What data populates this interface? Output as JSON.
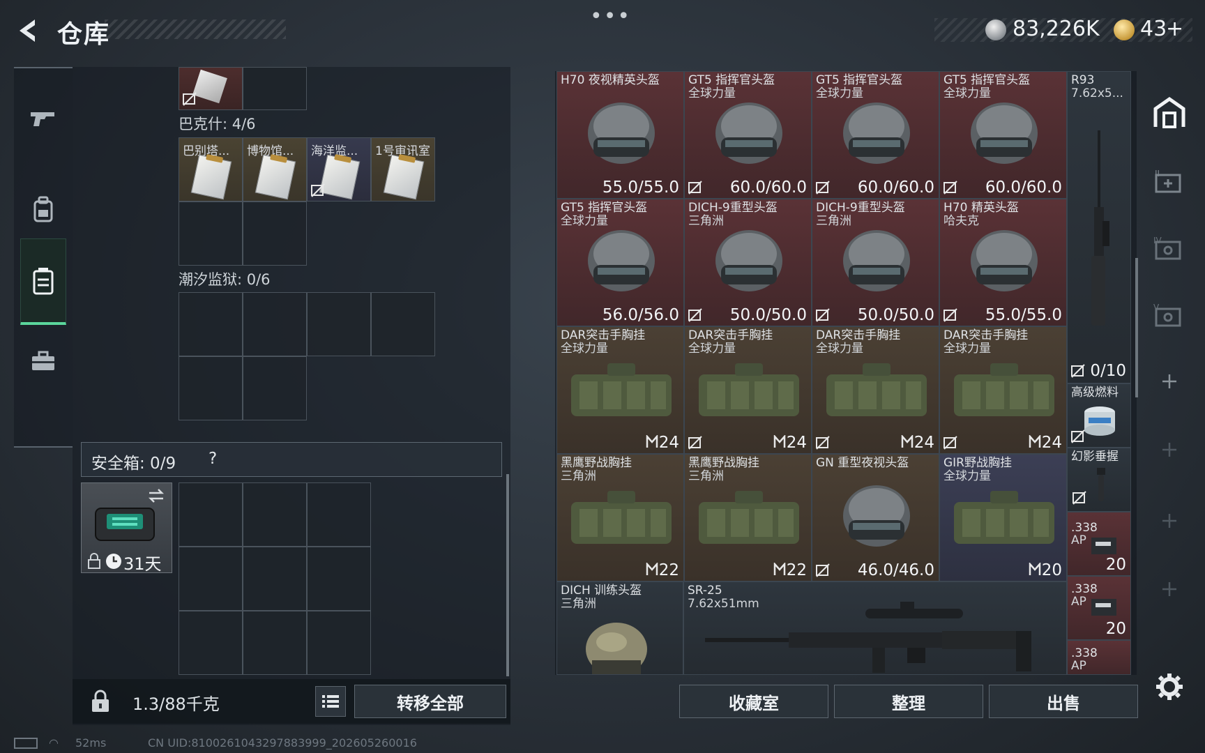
{
  "header": {
    "title": "仓库",
    "menu_dots": "•••",
    "currency_silver": "83,226K",
    "currency_gold": "43",
    "gold_plus": "+"
  },
  "left_rail": {
    "items": [
      {
        "name": "weapons",
        "icon": "gun-icon"
      },
      {
        "name": "backpack",
        "icon": "backpack-icon"
      },
      {
        "name": "containers",
        "icon": "container-icon",
        "active": true
      },
      {
        "name": "toolbox",
        "icon": "toolbox-icon"
      }
    ]
  },
  "left_panel": {
    "section_bakshi": "巴克什: 4/6",
    "bakshi_docs": [
      "巴别塔...",
      "博物馆...",
      "海洋监...",
      "1号审讯室"
    ],
    "section_tidal": "潮汐监狱: 0/6",
    "safebox_label": "安全箱: 0/9",
    "safebox_help": "?",
    "safe_item_days": "31天",
    "weight": "1.3/88千克",
    "transfer_all": "转移全部"
  },
  "inventory": {
    "row1": [
      {
        "name": "H70 夜视精英头盔",
        "sub": "",
        "value": "55.0/55.0",
        "bg": "red"
      },
      {
        "name": "GT5 指挥官头盔",
        "sub": "全球力量",
        "value": "60.0/60.0",
        "bg": "red"
      },
      {
        "name": "GT5 指挥官头盔",
        "sub": "全球力量",
        "value": "60.0/60.0",
        "bg": "red"
      },
      {
        "name": "GT5 指挥官头盔",
        "sub": "全球力量",
        "value": "60.0/60.0",
        "bg": "red"
      }
    ],
    "row2": [
      {
        "name": "GT5 指挥官头盔",
        "sub": "全球力量",
        "value": "56.0/56.0",
        "bg": "red"
      },
      {
        "name": "DICH-9重型头盔",
        "sub": "三角洲",
        "value": "50.0/50.0",
        "bg": "red"
      },
      {
        "name": "DICH-9重型头盔",
        "sub": "三角洲",
        "value": "50.0/50.0",
        "bg": "red"
      },
      {
        "name": "H70 精英头盔",
        "sub": "哈夫克",
        "value": "55.0/55.0",
        "bg": "red"
      }
    ],
    "row3": [
      {
        "name": "DAR突击手胸挂",
        "sub": "全球力量",
        "value": "24",
        "bg": "brown"
      },
      {
        "name": "DAR突击手胸挂",
        "sub": "全球力量",
        "value": "24",
        "bg": "brown"
      },
      {
        "name": "DAR突击手胸挂",
        "sub": "全球力量",
        "value": "24",
        "bg": "brown"
      },
      {
        "name": "DAR突击手胸挂",
        "sub": "全球力量",
        "value": "24",
        "bg": "brown"
      }
    ],
    "row4": [
      {
        "name": "黑鹰野战胸挂",
        "sub": "三角洲",
        "value": "22",
        "bg": "brown"
      },
      {
        "name": "黑鹰野战胸挂",
        "sub": "三角洲",
        "value": "22",
        "bg": "brown"
      },
      {
        "name": "GN 重型夜视头盔",
        "sub": "",
        "value": "46.0/46.0",
        "bg": "brown"
      },
      {
        "name": "GIR野战胸挂",
        "sub": "全球力量",
        "value": "20",
        "bg": "blue"
      }
    ],
    "row5_helmet": {
      "name": "DICH 训练头盔",
      "sub": "三角洲"
    },
    "row5_rifle": {
      "name": "SR-25",
      "sub": "7.62x51mm"
    },
    "col5": {
      "r93_name": "R93",
      "r93_sub": "7.62x5...",
      "r93_value": "0/10",
      "fuel_name": "高级燃料",
      "phantom_name": "幻影垂握",
      "ammo1_name": ".338",
      "ammo1_sub": "AP",
      "ammo1_qty": "20",
      "ammo2_name": ".338",
      "ammo2_sub": "AP",
      "ammo2_qty": "20",
      "ammo3_name": ".338",
      "ammo3_sub": "AP"
    }
  },
  "bottom_buttons": {
    "collection": "收藏室",
    "organize": "整理",
    "sell": "出售"
  },
  "status_bar": {
    "ping": "52ms",
    "uid": "CN UID:8100261043297883999_202605260016"
  }
}
